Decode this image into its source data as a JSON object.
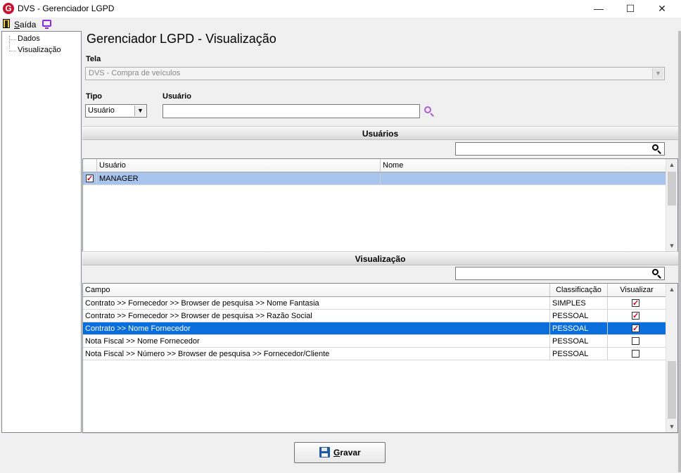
{
  "window": {
    "title": "DVS - Gerenciador LGPD",
    "logo_letter": "G",
    "minimize": "—",
    "maximize": "☐",
    "close": "✕"
  },
  "menu": {
    "exit_prefix": "",
    "exit_access": "S",
    "exit_rest": "aída"
  },
  "tree": {
    "items": [
      "Dados",
      "Visualização"
    ]
  },
  "page_title": "Gerenciador LGPD - Visualização",
  "tela": {
    "label": "Tela",
    "value": "DVS - Compra de veículos"
  },
  "tipo": {
    "label": "Tipo",
    "value": "Usuário"
  },
  "usuario": {
    "label": "Usuário",
    "value": ""
  },
  "usuarios_section": {
    "title": "Usuários",
    "columns": [
      "Usuário",
      "Nome"
    ],
    "rows": [
      {
        "checked": true,
        "usuario": "MANAGER",
        "nome": ""
      }
    ]
  },
  "visualizacao_section": {
    "title": "Visualização",
    "columns": [
      "Campo",
      "Classificação",
      "Visualizar"
    ],
    "rows": [
      {
        "campo": "Contrato >> Fornecedor >> Browser de pesquisa >> Nome Fantasia",
        "classificacao": "SIMPLES",
        "visualizar": true
      },
      {
        "campo": "Contrato >> Fornecedor >> Browser de pesquisa >> Razão Social",
        "classificacao": "PESSOAL",
        "visualizar": true
      },
      {
        "campo": "Contrato >> Nome Fornecedor",
        "classificacao": "PESSOAL",
        "visualizar": true
      },
      {
        "campo": "Nota Fiscal  >> Nome Fornecedor",
        "classificacao": "PESSOAL",
        "visualizar": false
      },
      {
        "campo": "Nota Fiscal >> Número  >> Browser de pesquisa >> Fornecedor/Cliente",
        "classificacao": "PESSOAL",
        "visualizar": false
      }
    ],
    "selected_row": 2
  },
  "save_button": {
    "access": "G",
    "rest": "ravar"
  },
  "colors": {
    "selection_light": "#a9c4ec",
    "selection_dark": "#0a6fdc",
    "logo": "#c8102e",
    "search_accent": "#b05bd6"
  }
}
